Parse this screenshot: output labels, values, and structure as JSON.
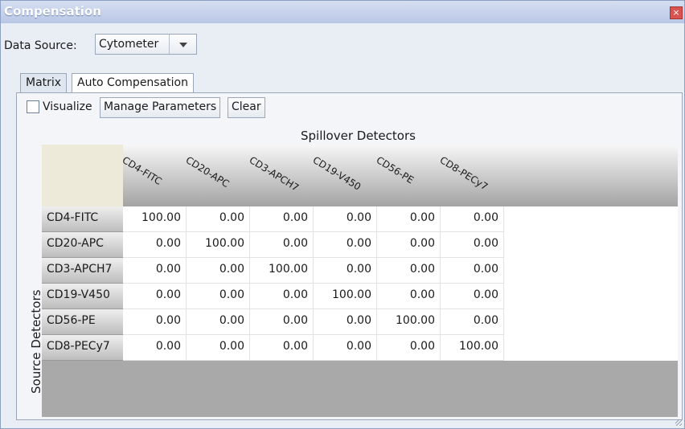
{
  "window": {
    "title": "Compensation"
  },
  "data_source": {
    "label": "Data Source:",
    "value": "Cytometer"
  },
  "tabs": [
    {
      "label": "Matrix",
      "active": true
    },
    {
      "label": "Auto Compensation",
      "active": false
    }
  ],
  "toolbar": {
    "visualize_label": "Visualize",
    "manage_label": "Manage Parameters",
    "clear_label": "Clear"
  },
  "matrix": {
    "spillover_label": "Spillover Detectors",
    "source_label": "Source Detectors",
    "columns": [
      "CD4-FITC",
      "CD20-APC",
      "CD3-APCH7",
      "CD19-V450",
      "CD56-PE",
      "CD8-PECy7"
    ],
    "rows": [
      {
        "label": "CD4-FITC",
        "values": [
          "100.00",
          "0.00",
          "0.00",
          "0.00",
          "0.00",
          "0.00"
        ]
      },
      {
        "label": "CD20-APC",
        "values": [
          "0.00",
          "100.00",
          "0.00",
          "0.00",
          "0.00",
          "0.00"
        ]
      },
      {
        "label": "CD3-APCH7",
        "values": [
          "0.00",
          "0.00",
          "100.00",
          "0.00",
          "0.00",
          "0.00"
        ]
      },
      {
        "label": "CD19-V450",
        "values": [
          "0.00",
          "0.00",
          "0.00",
          "100.00",
          "0.00",
          "0.00"
        ]
      },
      {
        "label": "CD56-PE",
        "values": [
          "0.00",
          "0.00",
          "0.00",
          "0.00",
          "100.00",
          "0.00"
        ]
      },
      {
        "label": "CD8-PECy7",
        "values": [
          "0.00",
          "0.00",
          "0.00",
          "0.00",
          "0.00",
          "100.00"
        ]
      }
    ]
  }
}
